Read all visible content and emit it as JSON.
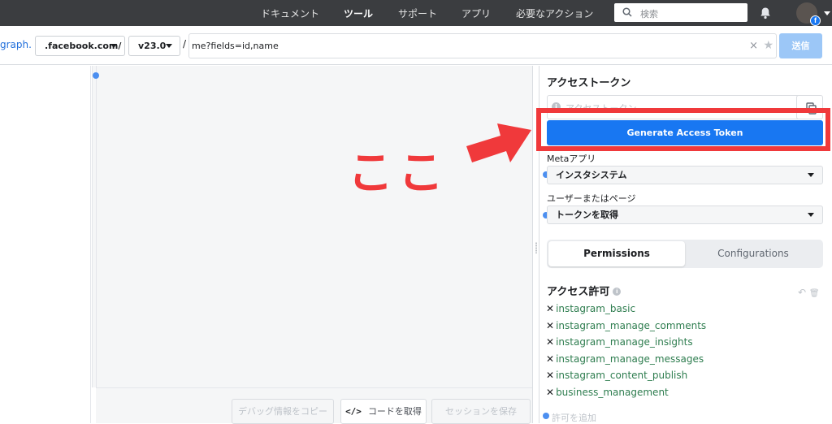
{
  "topnav": {
    "links": [
      "ドキュメント",
      "ツール",
      "サポート",
      "アプリ",
      "必要なアクション"
    ],
    "active": "ツール",
    "search_placeholder": "検索",
    "bell_icon": "bell-icon",
    "avatar_badge": "f"
  },
  "urlbar": {
    "prefix": "graph.",
    "host": ".facebook.com/",
    "version": "v23.0",
    "slash": "/",
    "path": "me?fields=id,name",
    "clear": "×",
    "star": "★",
    "send_label": "送信"
  },
  "editor": {
    "copy_debug": "デバッグ情報をコピー",
    "get_code": "コードを取得",
    "get_code_icon": "</>",
    "save_session": "セッションを保存"
  },
  "side": {
    "token_title": "アクセストークン",
    "token_placeholder": "アクセストークン",
    "info_glyph": "i",
    "generate_label": "Generate Access Token",
    "meta_app_label": "Metaアプリ",
    "meta_app_value": "インスタシステム",
    "user_page_label": "ユーザーまたはページ",
    "user_page_value": "トークンを取得",
    "tabs": [
      "Permissions",
      "Configurations"
    ],
    "perm_title": "アクセス許可",
    "undo_icon": "↶",
    "trash_icon": "🗑",
    "remove_glyph": "✕",
    "permissions": [
      "instagram_basic",
      "instagram_manage_comments",
      "instagram_manage_insights",
      "instagram_manage_messages",
      "instagram_content_publish",
      "business_management"
    ],
    "add_permission": "許可を追加"
  },
  "annotation": {
    "text": "ここ",
    "color": "#f0393b"
  },
  "colors": {
    "brand_blue": "#1877f2",
    "send_disabled": "#9cc7f7",
    "nav_bg": "#3b3d40",
    "permission_green": "#2e7d4f"
  }
}
